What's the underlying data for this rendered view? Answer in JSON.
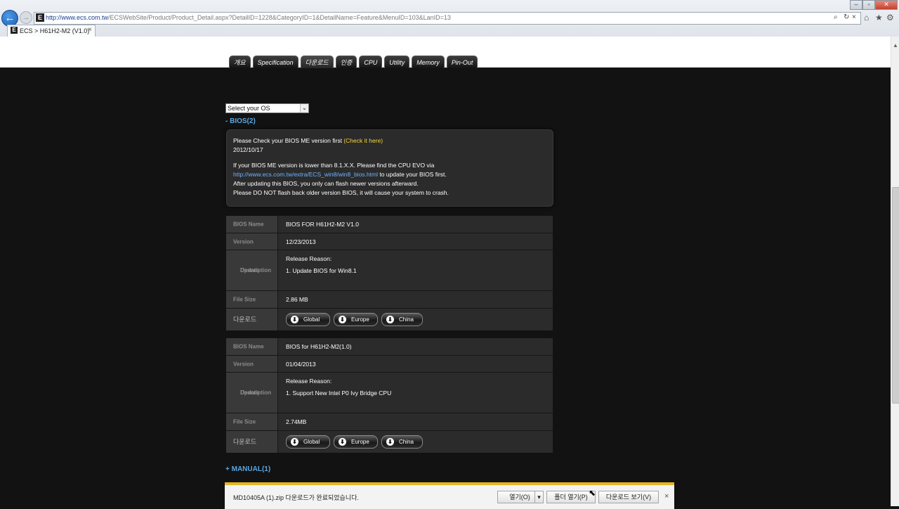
{
  "browser": {
    "url_prefix": "http://www.ecs.com.tw",
    "url_rest": "/ECSWebSite/Product/Product_Detail.aspx?DetailID=1228&CategoryID=1&DetailName=Feature&MenuID=103&LanID=13",
    "site_icon_letter": "E",
    "tab_title": "ECS > H61H2-M2 (V1.0)",
    "tab_close": "×",
    "back_glyph": "←",
    "fwd_glyph": "→",
    "search_glyph": "⌕",
    "refresh_glyph": "↻",
    "close_glyph": "×",
    "home_glyph": "⌂",
    "favorites_glyph": "★",
    "tools_glyph": "⚙",
    "window_min": "–",
    "window_max": "▫",
    "window_close": "✕"
  },
  "nav_tabs": [
    "개요",
    "Specification",
    "다운로드",
    "인증",
    "CPU",
    "Utility",
    "Memory",
    "Pin-Out"
  ],
  "os_select": {
    "selected": "Select your OS",
    "arrow": "⌄"
  },
  "bios_section": {
    "title": "- BIOS(2)"
  },
  "notice": {
    "line1_prefix": "Please Check your BIOS ME version first",
    "line1_link": "(Check it here)",
    "date": "2012/10/17",
    "line3": "If your BIOS ME version is lower than 8.1.X.X. Please find the CPU EVO via",
    "line4_link": "http://www.ecs.com.tw/extra/ECS_win8/win8_bios.html",
    "line4_suffix": "to update your BIOS first.",
    "line5": "After updating this BIOS, you only can flash newer versions afterward.",
    "line6": "Please DO NOT flash back older version BIOS, it will cause your system to crash."
  },
  "labels": {
    "bios_name": "BIOS Name",
    "version": "Version",
    "update_1": "Update",
    "update_2": "Description",
    "file_size": "File Size",
    "download": "다운로드",
    "release_reason": "Release Reason:"
  },
  "bios_entries": [
    {
      "name": "BIOS FOR H61H2-M2 V1.0",
      "version": "12/23/2013",
      "description": "1. Update BIOS for Win8.1",
      "file_size": "2.86 MB",
      "buttons": [
        "Global",
        "Europe",
        "China"
      ]
    },
    {
      "name": "BIOS for H61H2-M2(1.0)",
      "version": "01/04/2013",
      "description": "1. Support New Intel P0 Ivy Bridge CPU",
      "file_size": "2.74MB",
      "buttons": [
        "Global",
        "Europe",
        "China"
      ]
    }
  ],
  "dl_glyph": "⬇",
  "manual_section": {
    "title": "+ MANUAL(1)"
  },
  "download_bar": {
    "message": "MD10405A (1).zip 다운로드가 완료되었습니다.",
    "open": "열기(O)",
    "open_arrow": "▾",
    "open_folder": "폴더 열기(P)",
    "view_downloads": "다운로드 보기(V)",
    "close": "×"
  },
  "scroll_up": "▲",
  "cursor_glyph": "⬉"
}
